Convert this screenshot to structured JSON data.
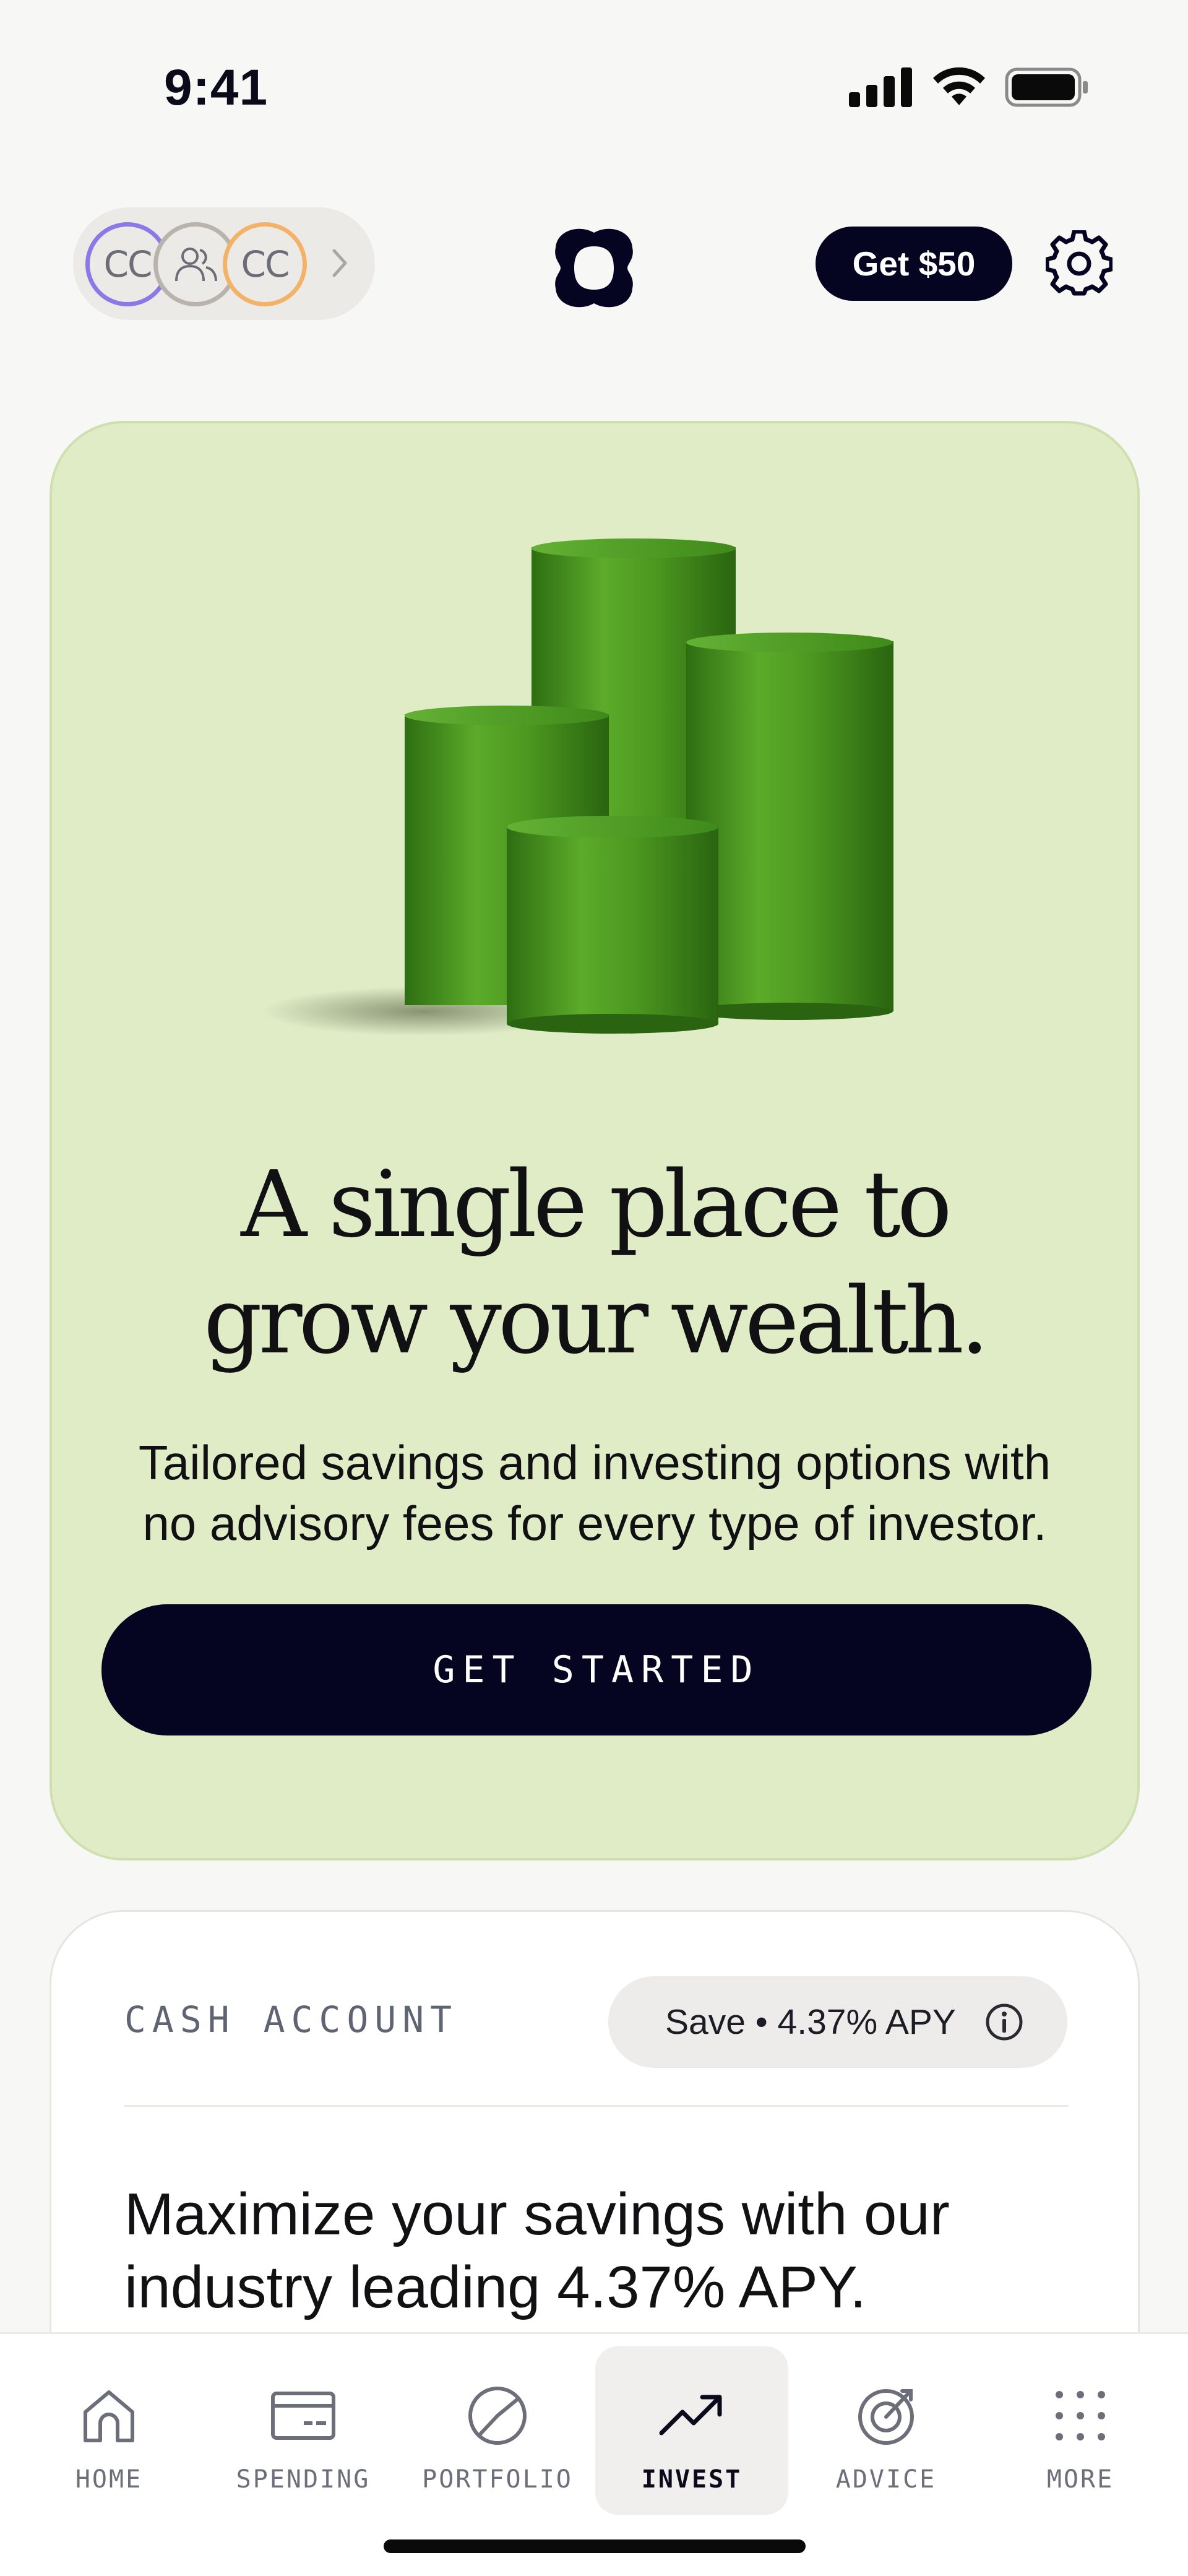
{
  "status_bar": {
    "time": "9:41"
  },
  "header": {
    "avatars": [
      "CC",
      "CC"
    ],
    "promo_button": "Get $50"
  },
  "hero": {
    "title": "A single place to grow your wealth.",
    "subtitle": "Tailored savings and investing options with no advisory fees for every type of investor.",
    "cta": "GET STARTED",
    "background_color": "#e0ecc6"
  },
  "cash_account": {
    "label": "CASH ACCOUNT",
    "apy_pill": "Save • 4.37% APY",
    "headline": "Maximize your savings with our industry leading 4.37% APY."
  },
  "bottom_nav": {
    "items": [
      {
        "label": "HOME",
        "icon": "home-icon"
      },
      {
        "label": "SPENDING",
        "icon": "card-icon"
      },
      {
        "label": "PORTFOLIO",
        "icon": "pie-chart-icon"
      },
      {
        "label": "INVEST",
        "icon": "trending-up-icon",
        "active": true
      },
      {
        "label": "ADVICE",
        "icon": "target-icon"
      },
      {
        "label": "MORE",
        "icon": "grid-dots-icon"
      }
    ]
  },
  "colors": {
    "primary_dark": "#050521",
    "hero_green": "#e0ecc6",
    "avatar_purple": "#8c79e8",
    "avatar_orange": "#f2b368"
  }
}
